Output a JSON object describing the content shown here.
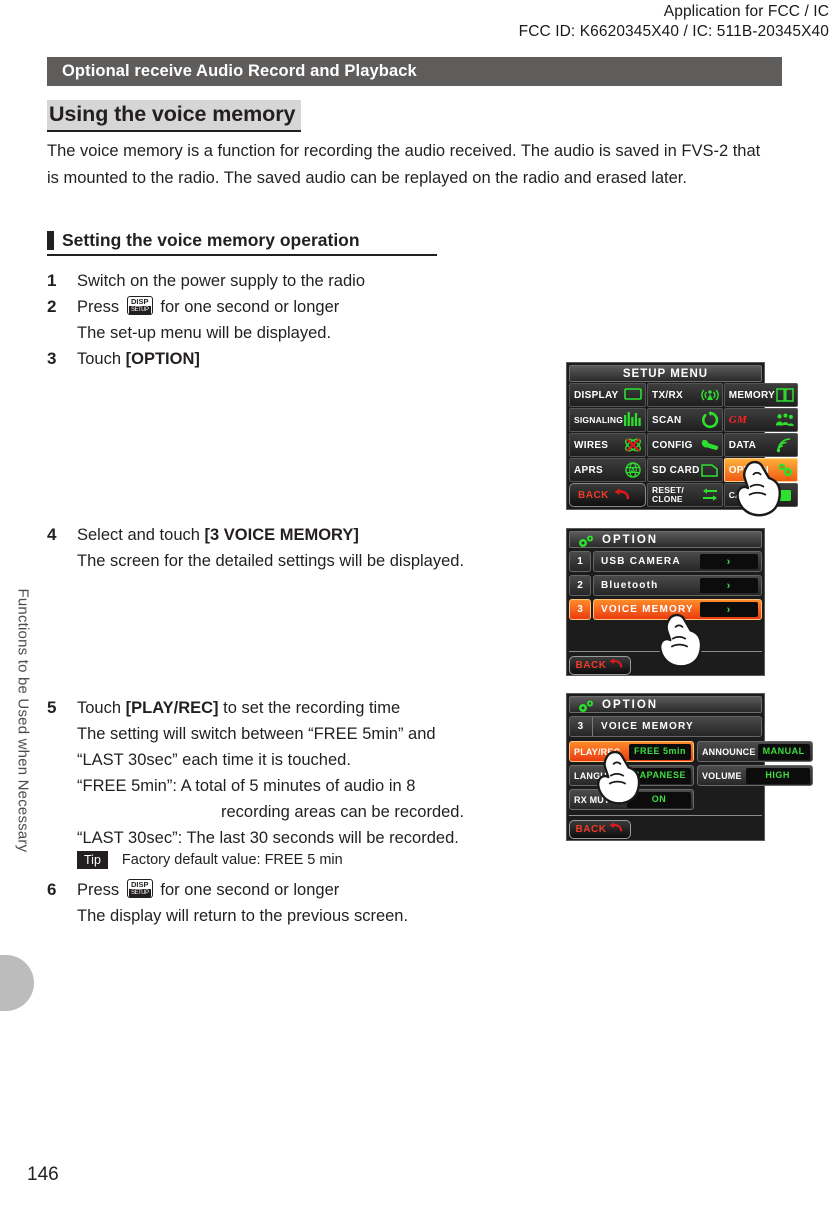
{
  "fcc": {
    "line1": "Application for FCC / IC",
    "line2": "FCC ID: K6620345X40 / IC: 511B-20345X40"
  },
  "side_tab_label": "Functions to be Used when Necessary",
  "page_number": "146",
  "section_bar": "Optional receive Audio Record and Playback",
  "heading1": "Using the voice memory",
  "intro": "The voice memory is a function for recording the audio received. The audio is saved in FVS-2 that is mounted to the radio. The saved audio can be replayed on the radio and erased later.",
  "heading2": "Setting the voice memory operation",
  "steps": {
    "s1_num": "1",
    "s1_text": "Switch on the power supply to the radio",
    "s2_num": "2",
    "s2_pre": "Press",
    "s2_post": "for one second or longer",
    "s2_sub": "The set-up menu will be displayed.",
    "s3_num": "3",
    "s3_pre": "Touch",
    "s3_bold": "[OPTION]",
    "s4_num": "4",
    "s4_pre": "Select and touch",
    "s4_bold": "[3 VOICE MEMORY]",
    "s4_sub": "The screen for the detailed settings will be displayed.",
    "s5_num": "5",
    "s5_pre": "Touch",
    "s5_bold": "[PLAY/REC]",
    "s5_post": "to set the recording time",
    "s5_sub1": "The setting will switch between “FREE 5min” and",
    "s5_sub2": "“LAST 30sec” each time it is touched.",
    "s5_sub3": "“FREE 5min”: A total of 5 minutes of audio in 8",
    "s5_sub4": "recording areas can be recorded.",
    "s5_sub5": "“LAST 30sec”: The last 30 seconds will be recorded.",
    "s6_num": "6",
    "s6_pre": "Press",
    "s6_post": "for one second or longer",
    "s6_sub": "The display will return to the previous screen."
  },
  "tip": {
    "badge": "Tip",
    "text": "Factory default value: FREE 5 min"
  },
  "disp_key": {
    "top": "DISP",
    "bottom": "SETUP"
  },
  "lcd_setup": {
    "title": "SETUP MENU",
    "cells": [
      {
        "label": "DISPLAY",
        "icon": "monitor-icon",
        "selected": false,
        "small": false
      },
      {
        "label": "TX/RX",
        "icon": "antenna-icon",
        "selected": false,
        "small": false
      },
      {
        "label": "MEMORY",
        "icon": "book-icon",
        "selected": false,
        "small": false
      },
      {
        "label": "SIGNALING",
        "icon": "bars-icon",
        "selected": false,
        "small": true
      },
      {
        "label": "SCAN",
        "icon": "refresh-icon",
        "selected": false,
        "small": false
      },
      {
        "label": "GM",
        "icon": "group-icon",
        "selected": false,
        "small": false
      },
      {
        "label": "WIRES",
        "icon": "wires-icon",
        "selected": false,
        "small": false
      },
      {
        "label": "CONFIG",
        "icon": "wrench-icon",
        "selected": false,
        "small": false
      },
      {
        "label": "DATA",
        "icon": "signal-icon",
        "selected": false,
        "small": false
      },
      {
        "label": "APRS",
        "icon": "globe-icon",
        "selected": false,
        "small": false
      },
      {
        "label": "SD CARD",
        "icon": "folder-icon",
        "selected": false,
        "small": false
      },
      {
        "label": "OPTION",
        "icon": "gears-icon",
        "selected": true,
        "small": false
      },
      {
        "label": "BACK",
        "icon": "back-arrow-icon",
        "selected": false,
        "small": false
      },
      {
        "label": "RESET/\nCLONE",
        "icon": "swap-icon",
        "selected": false,
        "small": true
      },
      {
        "label": "CALLSIGN",
        "icon": "callsign-icon",
        "selected": false,
        "small": true
      }
    ]
  },
  "lcd_option": {
    "title": "OPTION",
    "rows": [
      {
        "num": "1",
        "label": "USB CAMERA",
        "arrow": "›",
        "selected": false
      },
      {
        "num": "2",
        "label": "Bluetooth",
        "arrow": "›",
        "selected": false
      },
      {
        "num": "3",
        "label": "VOICE MEMORY",
        "arrow": "›",
        "selected": true
      }
    ],
    "back": "BACK"
  },
  "lcd_voice": {
    "title": "OPTION",
    "head_num": "3",
    "head_label": "VOICE MEMORY",
    "tiles": [
      {
        "label": "PLAY/REC",
        "value": "FREE 5min",
        "selected": true
      },
      {
        "label": "ANNOUNCE",
        "value": "MANUAL",
        "selected": false
      },
      {
        "label": "LANGUAGE",
        "value": "JAPANESE",
        "selected": false
      },
      {
        "label": "VOLUME",
        "value": "HIGH",
        "selected": false
      },
      {
        "label": "RX MUTE",
        "value": "ON",
        "selected": false
      }
    ],
    "back": "BACK"
  },
  "colors": {
    "section_bar": "#5f5c5c",
    "highlight": "#d6d6d6",
    "lcd_bg": "#1c1c1c",
    "lcd_accent_orange": "#ea3c10",
    "lcd_green": "#3fdd3f",
    "lcd_red": "#ef3b28"
  }
}
